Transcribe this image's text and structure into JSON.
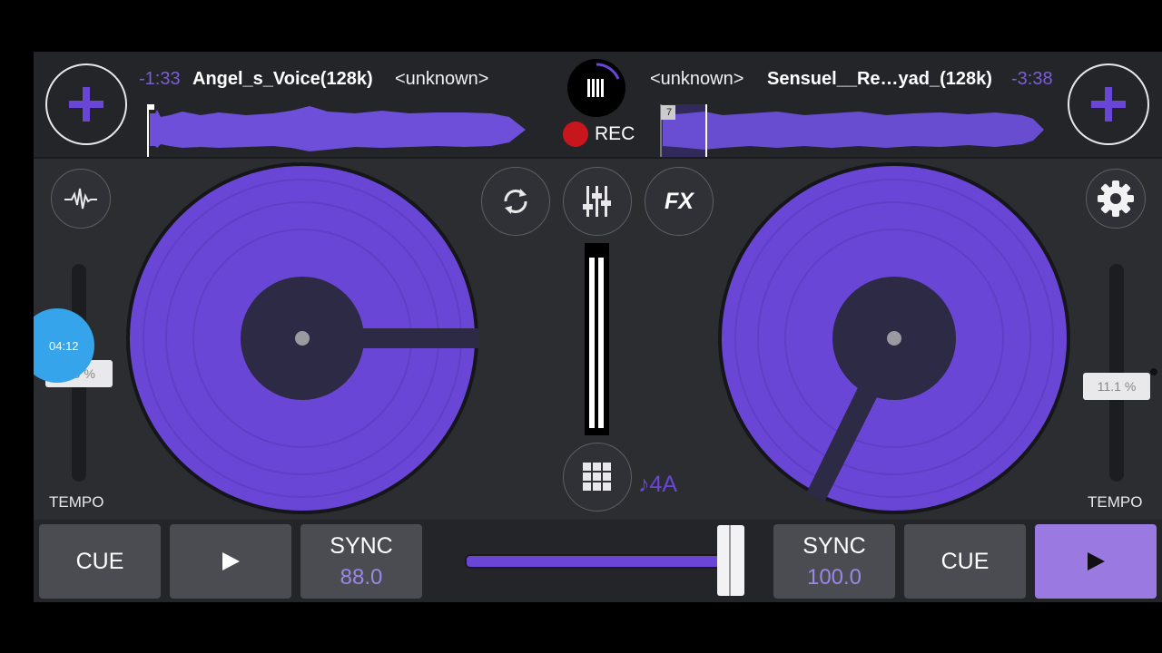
{
  "deckA": {
    "time_remaining": "-1:33",
    "title": "Angel_s_Voice(128k)",
    "artist": "<unknown>",
    "tempo_label": "TEMPO",
    "tempo_value": "0.0 %",
    "cue_label": "CUE",
    "play_icon": "play-icon",
    "sync_label": "SYNC",
    "bpm": "88.0"
  },
  "deckB": {
    "time_remaining": "-3:38",
    "title": "Sensuel__Re…yad_(128k)",
    "artist": "<unknown>",
    "cue_marker": "7",
    "tempo_label": "TEMPO",
    "tempo_value": "11.1 %",
    "cue_label": "CUE",
    "play_icon": "play-icon",
    "sync_label": "SYNC",
    "bpm": "100.0"
  },
  "center": {
    "rec_label": "REC",
    "fx_label": "FX",
    "key_label": "♪4A"
  },
  "overlay": {
    "badge_time": "04:12"
  },
  "colors": {
    "accent": "#6a46d6",
    "waveform": "#6d4fd9",
    "rec": "#c8161d",
    "background": "#2b2d31"
  }
}
